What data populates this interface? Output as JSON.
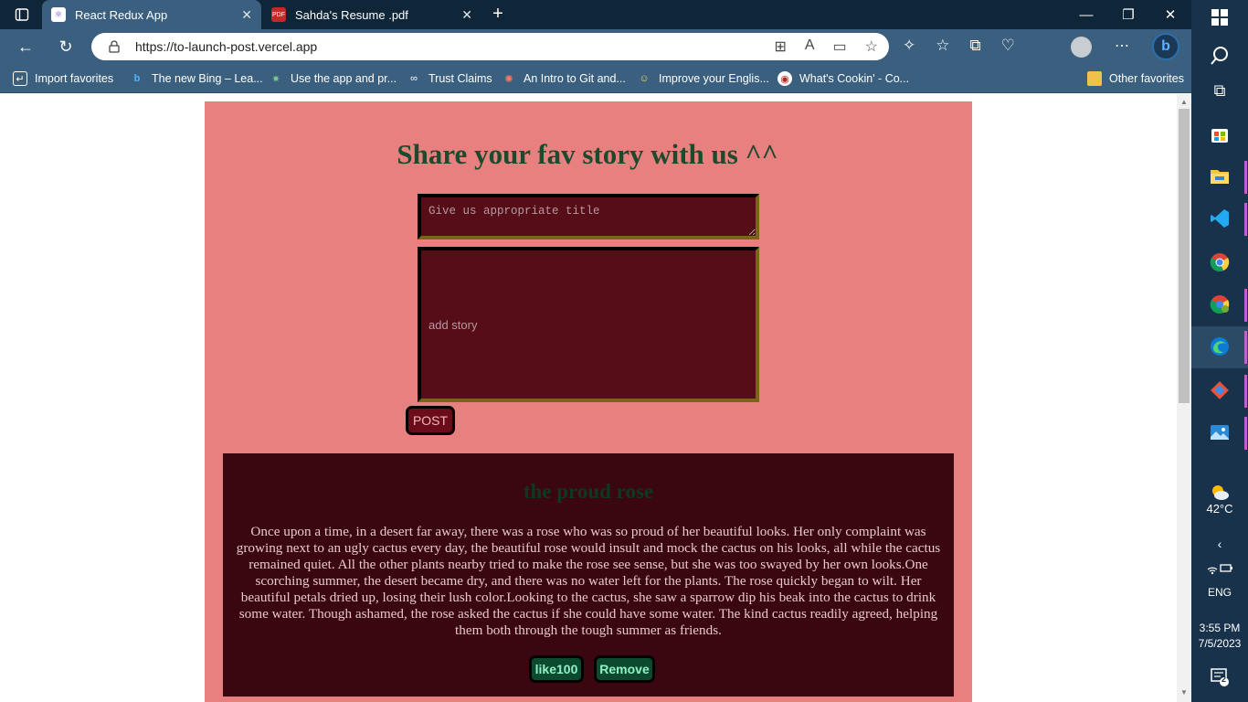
{
  "browser": {
    "tabs": [
      {
        "title": "React Redux App",
        "icon": "react-redux-icon",
        "active": true
      },
      {
        "title": "Sahda's Resume .pdf",
        "icon": "pdf-icon",
        "active": false
      }
    ],
    "url": "https://to-launch-post.vercel.app",
    "favorites": [
      {
        "label": "Import favorites",
        "icon": "import-icon"
      },
      {
        "label": "The new Bing – Lea...",
        "icon": "bing-icon"
      },
      {
        "label": "Use the app and pr...",
        "icon": "app-icon"
      },
      {
        "label": "Trust Claims",
        "icon": "trust-icon"
      },
      {
        "label": "An Intro to Git and...",
        "icon": "hubspot-icon"
      },
      {
        "label": "Improve your Englis...",
        "icon": "english-icon"
      },
      {
        "label": "What's Cookin' - Co...",
        "icon": "cooking-icon"
      },
      {
        "label": "Other favorites",
        "icon": "folder-icon"
      }
    ]
  },
  "page": {
    "heading": "Share your fav story with us ^^",
    "title_placeholder": "Give us appropriate title",
    "story_placeholder": "add story",
    "post_label": "POST",
    "stories": [
      {
        "title": "the proud rose",
        "body": "Once upon a time, in a desert far away, there was a rose who was so proud of her beautiful looks. Her only complaint was growing next to an ugly cactus every day, the beautiful rose would insult and mock the cactus on his looks, all while the cactus remained quiet. All the other plants nearby tried to make the rose see sense, but she was too swayed by her own looks.One scorching summer, the desert became dry, and there was no water left for the plants. The rose quickly began to wilt. Her beautiful petals dried up, losing their lush color.Looking to the cactus, she saw a sparrow dip his beak into the cactus to drink some water. Though ashamed, the rose asked the cactus if she could have some water. The kind cactus readily agreed, helping them both through the tough summer as friends.",
        "like_label": "like100",
        "remove_label": "Remove"
      }
    ]
  },
  "taskbar": {
    "weather": "42°C",
    "language": "ENG",
    "time": "3:55 PM",
    "date": "7/5/2023",
    "notifications": "2"
  }
}
